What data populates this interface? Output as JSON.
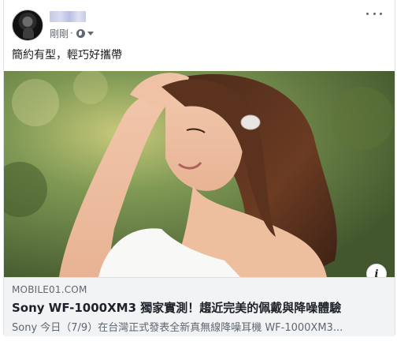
{
  "post": {
    "time": "剛剛",
    "separator": "·",
    "audience_icon": "globe-icon",
    "text": "簡約有型，輕巧好攜帶"
  },
  "link": {
    "domain": "MOBILE01.COM",
    "title": "Sony WF-1000XM3 獨家實測！趨近完美的佩戴與降噪體驗",
    "description": "Sony 今日（7/9）在台灣正式發表全新真無線降噪耳機 WF-1000XM3..."
  },
  "colors": {
    "link_bg": "#f2f3f5",
    "meta_text": "#616770",
    "border": "#dddfe2"
  }
}
